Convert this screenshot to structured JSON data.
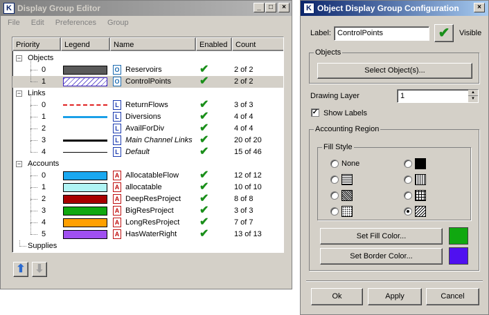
{
  "editor": {
    "title": "Display Group Editor",
    "menu": [
      "File",
      "Edit",
      "Preferences",
      "Group"
    ],
    "columns": [
      "Priority",
      "Legend",
      "Name",
      "Enabled",
      "Count"
    ],
    "groups": [
      {
        "label": "Objects",
        "rows": [
          {
            "priority": "0",
            "name": "Reservoirs",
            "count": "2 of 2",
            "legend": "fill",
            "color": "#5a5a5a",
            "icon": "object-icon",
            "italic": false
          },
          {
            "priority": "1",
            "name": "ControlPoints",
            "count": "2 of 2",
            "legend": "hatch",
            "color": "#ffffff",
            "icon": "object-icon",
            "italic": false,
            "selected": true
          }
        ]
      },
      {
        "label": "Links",
        "rows": [
          {
            "priority": "0",
            "name": "ReturnFlows",
            "count": "3 of 3",
            "legend": "dashed",
            "color": "#e02020",
            "icon": "link-icon",
            "italic": false
          },
          {
            "priority": "1",
            "name": "Diversions",
            "count": "4 of 4",
            "legend": "line",
            "color": "#1aa0e8",
            "icon": "link-icon",
            "italic": false
          },
          {
            "priority": "2",
            "name": "AvailForDiv",
            "count": "4 of 4",
            "legend": "none",
            "color": "#000000",
            "icon": "link-icon",
            "italic": false
          },
          {
            "priority": "3",
            "name": "Main Channel Links",
            "count": "20 of 20",
            "legend": "thick",
            "color": "#000000",
            "icon": "link-icon",
            "italic": true
          },
          {
            "priority": "4",
            "name": "Default",
            "count": "15 of 46",
            "legend": "thin",
            "color": "#000000",
            "icon": "link-icon",
            "italic": true
          }
        ]
      },
      {
        "label": "Accounts",
        "rows": [
          {
            "priority": "0",
            "name": "AllocatableFlow",
            "count": "12 of 12",
            "legend": "fill",
            "color": "#1aa8f0",
            "icon": "account-icon",
            "italic": false
          },
          {
            "priority": "1",
            "name": "allocatable",
            "count": "10 of 10",
            "legend": "fill",
            "color": "#b0f4f4",
            "icon": "account-icon",
            "italic": false
          },
          {
            "priority": "2",
            "name": "DeepResProject",
            "count": "8 of 8",
            "legend": "fill",
            "color": "#a80000",
            "icon": "account-icon",
            "italic": false
          },
          {
            "priority": "3",
            "name": "BigResProject",
            "count": "3 of 3",
            "legend": "fill",
            "color": "#10a810",
            "icon": "account-icon",
            "italic": false
          },
          {
            "priority": "4",
            "name": "LongResProject",
            "count": "7 of 7",
            "legend": "fill",
            "color": "#ffa000",
            "icon": "account-icon",
            "italic": false
          },
          {
            "priority": "5",
            "name": "HasWaterRight",
            "count": "13 of 13",
            "legend": "fill",
            "color": "#a050f0",
            "icon": "account-icon",
            "italic": false
          }
        ]
      },
      {
        "label": "Supplies",
        "rows": []
      }
    ]
  },
  "config": {
    "title": "Object Display Group Configuration",
    "label_caption": "Label:",
    "label_value": "ControlPoints",
    "visible_caption": "Visible",
    "objects_group": "Objects",
    "select_objects": "Select Object(s)...",
    "drawing_layer_caption": "Drawing Layer",
    "drawing_layer_value": "1",
    "show_labels": "Show Labels",
    "accounting_region": "Accounting Region",
    "fill_style": "Fill Style",
    "none_label": "None",
    "set_fill_color": "Set Fill Color...",
    "set_border_color": "Set Border Color...",
    "fill_color": "#10a810",
    "border_color": "#5010f0",
    "ok": "Ok",
    "apply": "Apply",
    "cancel": "Cancel"
  }
}
